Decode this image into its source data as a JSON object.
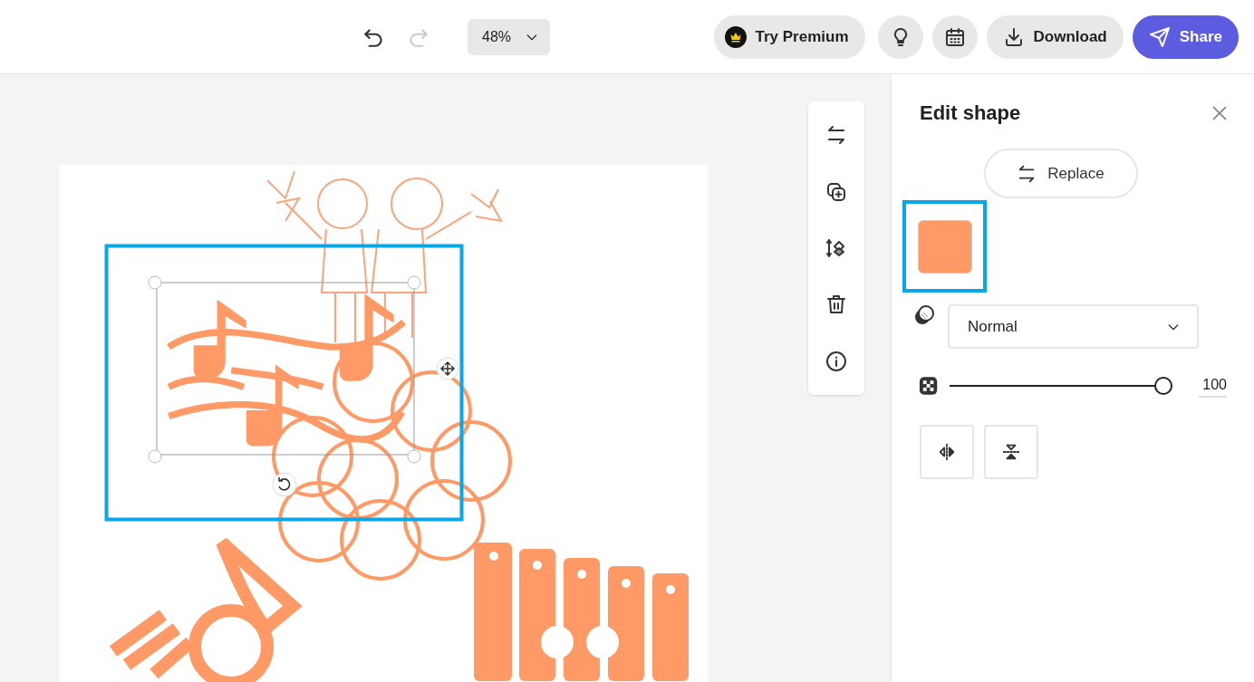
{
  "top_bar": {
    "undo": {
      "disabled": false
    },
    "redo": {
      "disabled": true
    },
    "zoom": "48%",
    "premium_button": "Try Premium",
    "download_button": "Download",
    "share_button": "Share"
  },
  "canvas_tools": [
    {
      "kind": "replace"
    },
    {
      "kind": "duplicate"
    },
    {
      "kind": "arrange"
    },
    {
      "kind": "delete"
    },
    {
      "kind": "info"
    }
  ],
  "panel": {
    "title": "Edit shape",
    "replace_button": "Replace",
    "swatch": {
      "color": "#ff9966",
      "selected": true
    },
    "blend_mode": "Normal",
    "opacity": {
      "level": 1,
      "reading": "100"
    },
    "flip_buttons": [
      {
        "kind": "horizontal"
      },
      {
        "kind": "vertical"
      }
    ]
  }
}
